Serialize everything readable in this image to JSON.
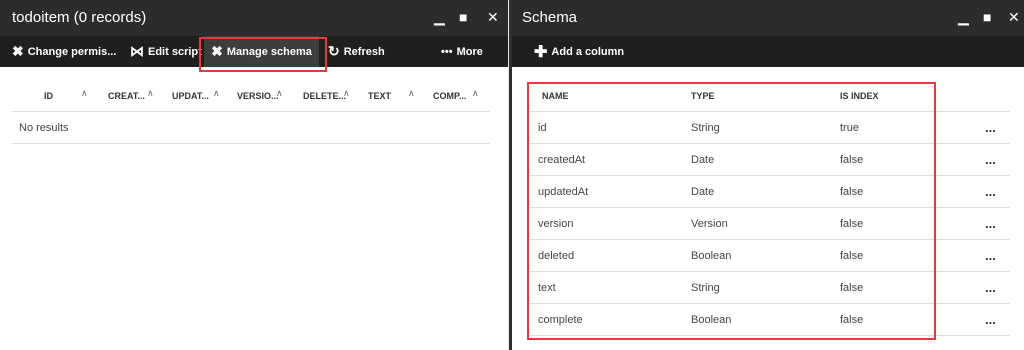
{
  "left": {
    "title": "todoitem (0 records)",
    "toolbar": {
      "change_permissions": "Change permis...",
      "edit_script": "Edit script",
      "manage_schema": "Manage schema",
      "refresh": "Refresh",
      "more": "More"
    },
    "columns": [
      "ID",
      "CREAT...",
      "UPDAT...",
      "VERSIO...",
      "DELETE...",
      "TEXT",
      "COMP..."
    ],
    "empty_text": "No results"
  },
  "right": {
    "title": "Schema",
    "toolbar": {
      "add_column": "Add a column"
    },
    "headers": {
      "name": "NAME",
      "type": "TYPE",
      "is_index": "IS INDEX"
    },
    "rows": [
      {
        "name": "id",
        "type": "String",
        "is_index": "true"
      },
      {
        "name": "createdAt",
        "type": "Date",
        "is_index": "false"
      },
      {
        "name": "updatedAt",
        "type": "Date",
        "is_index": "false"
      },
      {
        "name": "version",
        "type": "Version",
        "is_index": "false"
      },
      {
        "name": "deleted",
        "type": "Boolean",
        "is_index": "false"
      },
      {
        "name": "text",
        "type": "String",
        "is_index": "false"
      },
      {
        "name": "complete",
        "type": "Boolean",
        "is_index": "false"
      }
    ],
    "row_menu": "..."
  },
  "colors": {
    "highlight": "#e8393f",
    "titlebar": "#2c2c2c",
    "toolbar": "#1f1f1f"
  },
  "icons": {
    "change_permissions": "wrench-cross-icon",
    "edit_script": "vs-code-icon",
    "manage_schema": "wrench-cross-icon",
    "refresh": "refresh-icon",
    "add_column": "plus-icon"
  }
}
